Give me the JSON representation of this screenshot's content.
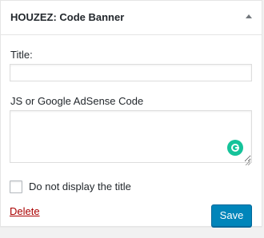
{
  "widget": {
    "title": "HOUZEZ: Code Banner",
    "toggle_icon": "arrow-up-icon"
  },
  "form": {
    "title_label": "Title:",
    "title_value": "",
    "code_label": "JS or Google AdSense Code",
    "code_value": "",
    "hide_title_label": "Do not display the title",
    "hide_title_checked": false
  },
  "actions": {
    "delete_label": "Delete",
    "save_label": "Save"
  },
  "icons": {
    "grammarly": "grammarly-icon",
    "resize": "resize-handle-icon"
  },
  "colors": {
    "primary_button": "#0085ba",
    "delete_link": "#aa0000",
    "grammarly": "#15c39a"
  }
}
